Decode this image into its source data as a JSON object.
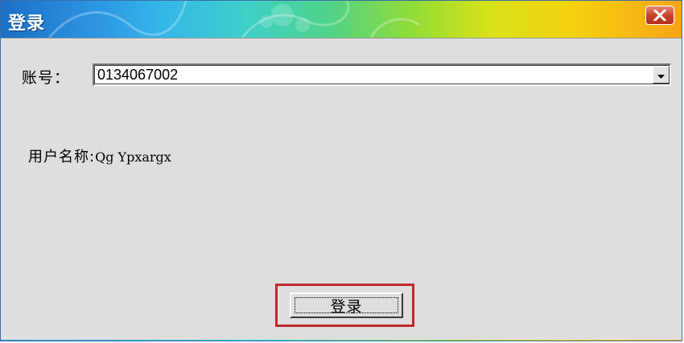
{
  "window": {
    "title": "登录",
    "close_icon": "close-icon"
  },
  "account": {
    "label": "账号：",
    "value": "0134067002",
    "dropdown_icon": "chevron-down-icon"
  },
  "user": {
    "label": "用户名称:",
    "value": "Qg Ypxargx"
  },
  "login_button": {
    "label": "登录"
  },
  "colors": {
    "title_start": "#1b6fc4",
    "title_end": "#f7a418",
    "highlight": "#c0282e",
    "close": "#c7432b",
    "dialog_bg": "#dedede"
  }
}
